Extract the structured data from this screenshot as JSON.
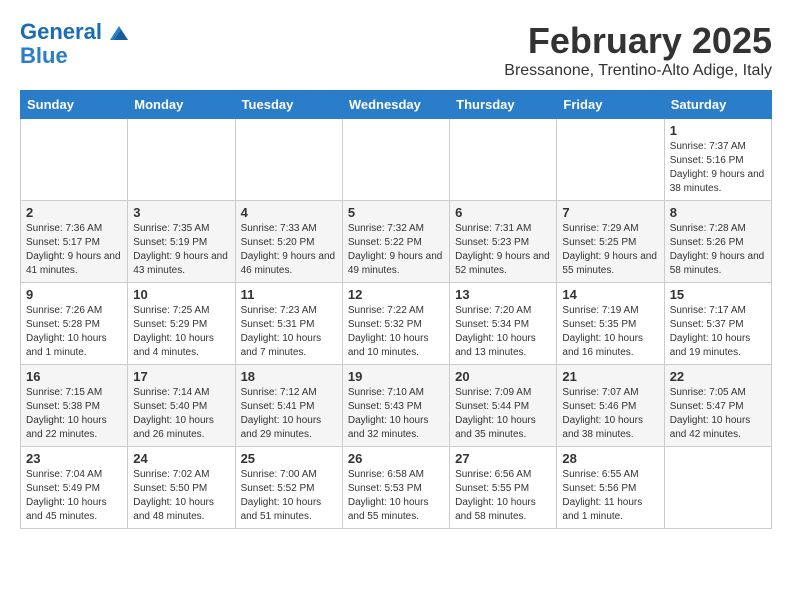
{
  "header": {
    "logo_line1": "General",
    "logo_line2": "Blue",
    "month_title": "February 2025",
    "location": "Bressanone, Trentino-Alto Adige, Italy"
  },
  "weekdays": [
    "Sunday",
    "Monday",
    "Tuesday",
    "Wednesday",
    "Thursday",
    "Friday",
    "Saturday"
  ],
  "weeks": [
    [
      {
        "day": "",
        "info": ""
      },
      {
        "day": "",
        "info": ""
      },
      {
        "day": "",
        "info": ""
      },
      {
        "day": "",
        "info": ""
      },
      {
        "day": "",
        "info": ""
      },
      {
        "day": "",
        "info": ""
      },
      {
        "day": "1",
        "info": "Sunrise: 7:37 AM\nSunset: 5:16 PM\nDaylight: 9 hours and 38 minutes."
      }
    ],
    [
      {
        "day": "2",
        "info": "Sunrise: 7:36 AM\nSunset: 5:17 PM\nDaylight: 9 hours and 41 minutes."
      },
      {
        "day": "3",
        "info": "Sunrise: 7:35 AM\nSunset: 5:19 PM\nDaylight: 9 hours and 43 minutes."
      },
      {
        "day": "4",
        "info": "Sunrise: 7:33 AM\nSunset: 5:20 PM\nDaylight: 9 hours and 46 minutes."
      },
      {
        "day": "5",
        "info": "Sunrise: 7:32 AM\nSunset: 5:22 PM\nDaylight: 9 hours and 49 minutes."
      },
      {
        "day": "6",
        "info": "Sunrise: 7:31 AM\nSunset: 5:23 PM\nDaylight: 9 hours and 52 minutes."
      },
      {
        "day": "7",
        "info": "Sunrise: 7:29 AM\nSunset: 5:25 PM\nDaylight: 9 hours and 55 minutes."
      },
      {
        "day": "8",
        "info": "Sunrise: 7:28 AM\nSunset: 5:26 PM\nDaylight: 9 hours and 58 minutes."
      }
    ],
    [
      {
        "day": "9",
        "info": "Sunrise: 7:26 AM\nSunset: 5:28 PM\nDaylight: 10 hours and 1 minute."
      },
      {
        "day": "10",
        "info": "Sunrise: 7:25 AM\nSunset: 5:29 PM\nDaylight: 10 hours and 4 minutes."
      },
      {
        "day": "11",
        "info": "Sunrise: 7:23 AM\nSunset: 5:31 PM\nDaylight: 10 hours and 7 minutes."
      },
      {
        "day": "12",
        "info": "Sunrise: 7:22 AM\nSunset: 5:32 PM\nDaylight: 10 hours and 10 minutes."
      },
      {
        "day": "13",
        "info": "Sunrise: 7:20 AM\nSunset: 5:34 PM\nDaylight: 10 hours and 13 minutes."
      },
      {
        "day": "14",
        "info": "Sunrise: 7:19 AM\nSunset: 5:35 PM\nDaylight: 10 hours and 16 minutes."
      },
      {
        "day": "15",
        "info": "Sunrise: 7:17 AM\nSunset: 5:37 PM\nDaylight: 10 hours and 19 minutes."
      }
    ],
    [
      {
        "day": "16",
        "info": "Sunrise: 7:15 AM\nSunset: 5:38 PM\nDaylight: 10 hours and 22 minutes."
      },
      {
        "day": "17",
        "info": "Sunrise: 7:14 AM\nSunset: 5:40 PM\nDaylight: 10 hours and 26 minutes."
      },
      {
        "day": "18",
        "info": "Sunrise: 7:12 AM\nSunset: 5:41 PM\nDaylight: 10 hours and 29 minutes."
      },
      {
        "day": "19",
        "info": "Sunrise: 7:10 AM\nSunset: 5:43 PM\nDaylight: 10 hours and 32 minutes."
      },
      {
        "day": "20",
        "info": "Sunrise: 7:09 AM\nSunset: 5:44 PM\nDaylight: 10 hours and 35 minutes."
      },
      {
        "day": "21",
        "info": "Sunrise: 7:07 AM\nSunset: 5:46 PM\nDaylight: 10 hours and 38 minutes."
      },
      {
        "day": "22",
        "info": "Sunrise: 7:05 AM\nSunset: 5:47 PM\nDaylight: 10 hours and 42 minutes."
      }
    ],
    [
      {
        "day": "23",
        "info": "Sunrise: 7:04 AM\nSunset: 5:49 PM\nDaylight: 10 hours and 45 minutes."
      },
      {
        "day": "24",
        "info": "Sunrise: 7:02 AM\nSunset: 5:50 PM\nDaylight: 10 hours and 48 minutes."
      },
      {
        "day": "25",
        "info": "Sunrise: 7:00 AM\nSunset: 5:52 PM\nDaylight: 10 hours and 51 minutes."
      },
      {
        "day": "26",
        "info": "Sunrise: 6:58 AM\nSunset: 5:53 PM\nDaylight: 10 hours and 55 minutes."
      },
      {
        "day": "27",
        "info": "Sunrise: 6:56 AM\nSunset: 5:55 PM\nDaylight: 10 hours and 58 minutes."
      },
      {
        "day": "28",
        "info": "Sunrise: 6:55 AM\nSunset: 5:56 PM\nDaylight: 11 hours and 1 minute."
      },
      {
        "day": "",
        "info": ""
      }
    ]
  ]
}
